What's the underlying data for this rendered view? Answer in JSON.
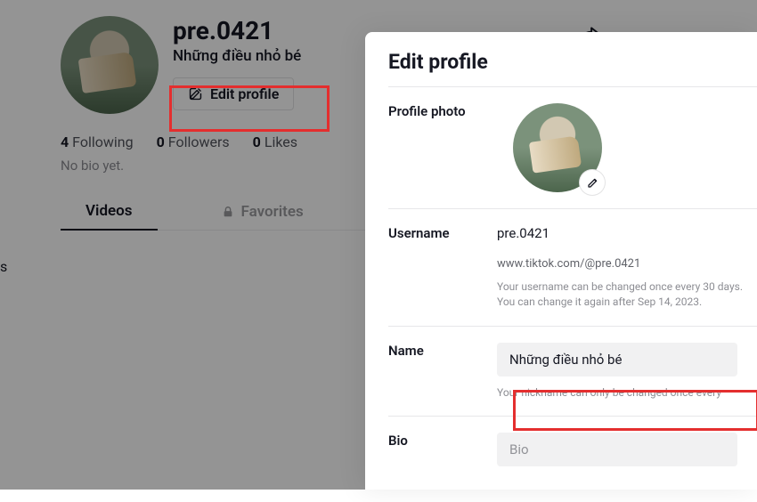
{
  "profile": {
    "username": "pre.0421",
    "displayName": "Những điều nhỏ bé",
    "editButtonLabel": "Edit profile",
    "stats": {
      "followingCount": "4",
      "followingLabel": "Following",
      "followersCount": "0",
      "followersLabel": "Followers",
      "likesCount": "0",
      "likesLabel": "Likes"
    },
    "bioPlaceholder": "No bio yet.",
    "tabs": {
      "videos": "Videos",
      "favorites": "Favorites"
    }
  },
  "modal": {
    "title": "Edit profile",
    "photoLabel": "Profile photo",
    "usernameLabel": "Username",
    "usernameValue": "pre.0421",
    "usernameUrl": "www.tiktok.com/@pre.0421",
    "usernameHint": "Your username can be changed once every 30 days. You can change it again after Sep 14, 2023.",
    "nameLabel": "Name",
    "nameValue": "Những điều nhỏ bé",
    "nameHint": "Your nickname can only be changed once every",
    "bioLabel": "Bio",
    "bioPlaceholder": "Bio"
  }
}
